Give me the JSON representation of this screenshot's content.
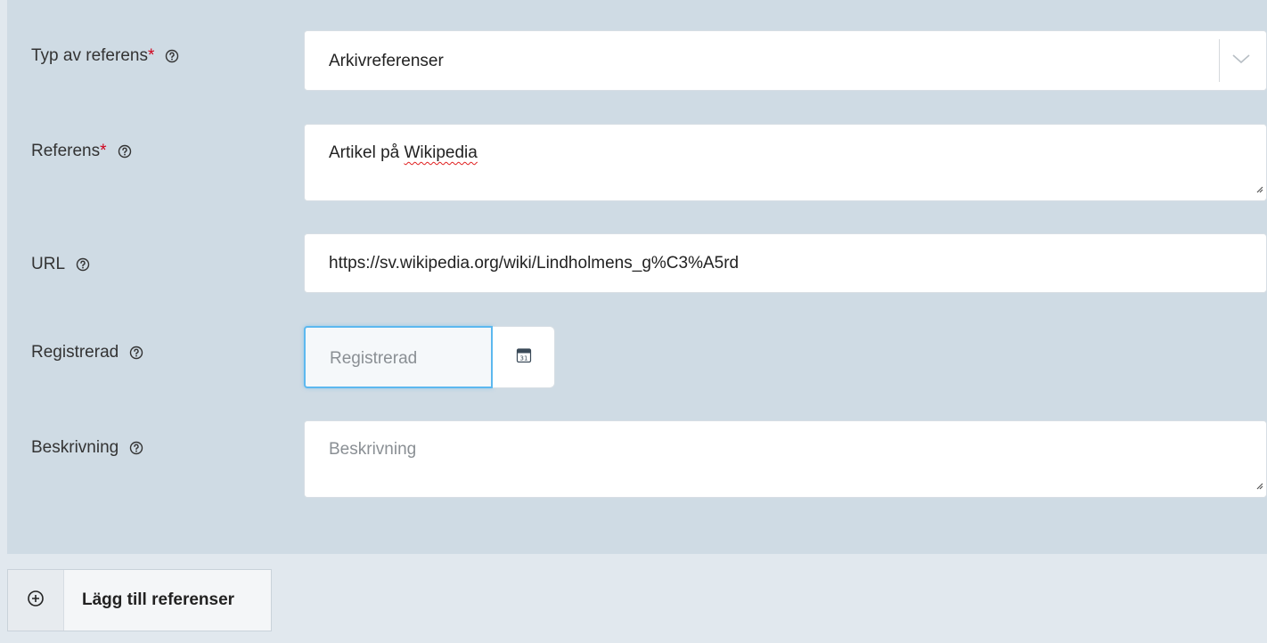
{
  "form": {
    "reference_type": {
      "label": "Typ av referens",
      "required_mark": "*",
      "value": "Arkivreferenser"
    },
    "reference": {
      "label": "Referens",
      "required_mark": "*",
      "value_prefix": "Artikel på ",
      "value_misspelled": "Wikipedia"
    },
    "url": {
      "label": "URL",
      "value": "https://sv.wikipedia.org/wiki/Lindholmens_g%C3%A5rd"
    },
    "registered": {
      "label": "Registrerad",
      "placeholder": "Registrerad"
    },
    "description": {
      "label": "Beskrivning",
      "placeholder": "Beskrivning"
    }
  },
  "actions": {
    "add_references_label": "Lägg till referenser"
  },
  "icons": {
    "help": "help-circle-icon",
    "dropdown": "chevron-down-icon",
    "calendar": "calendar-icon",
    "add": "plus-circle-icon",
    "resize": "resize-handle-icon"
  },
  "colors": {
    "panel_bg": "#cfdbe4",
    "page_bg": "#e1e8ee",
    "required": "#d0021b",
    "focus_border": "#5cb8ef"
  },
  "calendar_day": "31"
}
